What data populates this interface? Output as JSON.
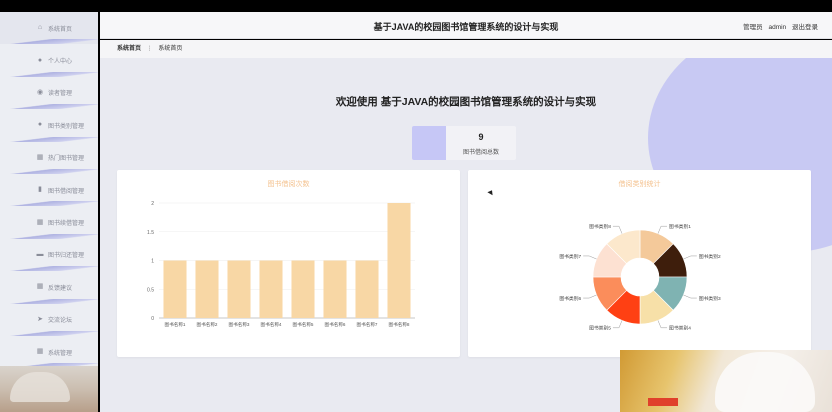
{
  "header": {
    "title": "基于JAVA的校园图书馆管理系统的设计与实现",
    "user_role": "管理员",
    "username": "admin",
    "logout_label": "退出登录"
  },
  "sidebar": {
    "items": [
      {
        "label": "系统首页",
        "icon": "home-icon"
      },
      {
        "label": "个人中心",
        "icon": "user-icon"
      },
      {
        "label": "读者管理",
        "icon": "location-icon"
      },
      {
        "label": "图书类别管理",
        "icon": "user-icon"
      },
      {
        "label": "热门图书管理",
        "icon": "grid-icon"
      },
      {
        "label": "图书借阅管理",
        "icon": "chart-icon"
      },
      {
        "label": "图书续借管理",
        "icon": "grid-icon"
      },
      {
        "label": "图书归还管理",
        "icon": "chat-icon"
      },
      {
        "label": "反馈建议",
        "icon": "grid-icon"
      },
      {
        "label": "交流论坛",
        "icon": "send-icon"
      },
      {
        "label": "系统管理",
        "icon": "grid-icon"
      }
    ]
  },
  "breadcrumb": {
    "home": "系统首页",
    "separator": "⋮",
    "current": "系统首页"
  },
  "main": {
    "welcome": "欢迎使用 基于JAVA的校园图书馆管理系统的设计与实现",
    "stat": {
      "value": "9",
      "label": "图书借阅总数"
    }
  },
  "colors": {
    "accent": "#c6c7f6",
    "bar": "#f8d7a5",
    "panel_title": "#f4c28f"
  },
  "chart_data": [
    {
      "type": "bar",
      "title": "图书借阅次数",
      "categories": [
        "图书名称1",
        "图书名称2",
        "图书名称3",
        "图书名称4",
        "图书名称5",
        "图书名称6",
        "图书名称7",
        "图书名称8"
      ],
      "values": [
        1,
        1,
        1,
        1,
        1,
        1,
        1,
        2
      ],
      "ylim": [
        0,
        2
      ],
      "yticks": [
        "0",
        "0.5",
        "1",
        "1.5",
        "2"
      ],
      "grid": true
    },
    {
      "type": "pie",
      "title": "借阅类别统计",
      "labels": [
        "图书类别1",
        "图书类别2",
        "图书类别3",
        "图书类别4",
        "图书类别5",
        "图书类别6",
        "图书类别7",
        "图书类别8"
      ],
      "values": [
        1,
        1,
        1,
        1,
        1,
        1,
        1,
        1
      ],
      "colors": [
        "#f4c99a",
        "#3e1e0c",
        "#7fb3b2",
        "#f7e0a8",
        "#ff4013",
        "#fb8d5b",
        "#fde1d2",
        "#fce8cc"
      ],
      "donut": true
    }
  ]
}
